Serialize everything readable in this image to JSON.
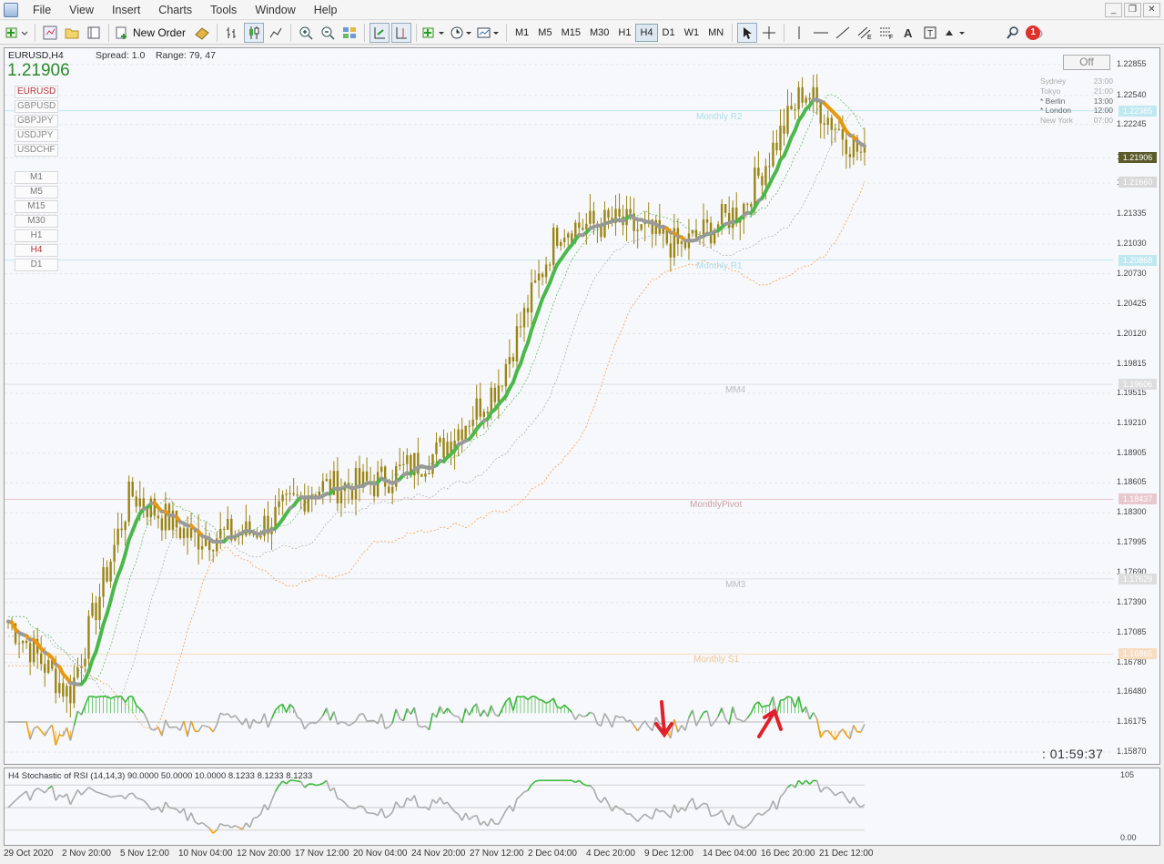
{
  "menubar": {
    "items": [
      "File",
      "View",
      "Insert",
      "Charts",
      "Tools",
      "Window",
      "Help"
    ]
  },
  "toolbar": {
    "new_order_label": "New Order",
    "timeframes": [
      "M1",
      "M5",
      "M15",
      "M30",
      "H1",
      "H4",
      "D1",
      "W1",
      "MN"
    ],
    "active_timeframe": "H4",
    "notification_count": "1"
  },
  "chart": {
    "title": "EURUSD,H4",
    "bid": "1.21906",
    "spread_label": "Spread: 1.0",
    "range_label": "Range: 79, 47",
    "symbols": [
      "EURUSD",
      "GBPUSD",
      "GBPJPY",
      "USDJPY",
      "USDCHF"
    ],
    "selected_symbol": "EURUSD",
    "timeframes_panel": [
      "M1",
      "M5",
      "M15",
      "M30",
      "H1",
      "H4",
      "D1"
    ],
    "selected_tf_panel": "H4",
    "off_button": "Off",
    "sessions": [
      {
        "name": "Sydney",
        "time": "23:00",
        "active": false
      },
      {
        "name": "Tokyo",
        "time": "21:00",
        "active": false
      },
      {
        "name": "* Berlin",
        "time": "13:00",
        "active": true
      },
      {
        "name": "* London",
        "time": "12:00",
        "active": true
      },
      {
        "name": "New York",
        "time": "07:00",
        "active": false
      }
    ],
    "countdown": ":   01:59:37",
    "levels": [
      {
        "label": "Monthly R2",
        "price": 1.22385,
        "color": "#bfe8f0"
      },
      {
        "label": "Monthly R1",
        "price": 1.20868,
        "color": "#bfe8f0"
      },
      {
        "label": "MM4",
        "price": 1.19606,
        "color": "#dddddd"
      },
      {
        "label": "MonthlyPivot",
        "price": 1.18437,
        "color": "#e8c8cc"
      },
      {
        "label": "MM3",
        "price": 1.17629,
        "color": "#dddddd"
      },
      {
        "label": "Monthly S1",
        "price": 1.16865,
        "color": "#f6dcc0"
      }
    ],
    "colors": {
      "candle": "#9a8414",
      "trend_up": "#4cb84c",
      "trend_down": "#e8980e",
      "trend_neutral": "#999999",
      "bid_tag": "#5a5a2a",
      "accent_arrow": "#e0202a"
    }
  },
  "price_axis": {
    "labels": [
      "1.22855",
      "1.22540",
      "1.22245",
      "1.21906",
      "1.21650",
      "1.21335",
      "1.21030",
      "1.20730",
      "1.20425",
      "1.20120",
      "1.19815",
      "1.19515",
      "1.19210",
      "1.18905",
      "1.18605",
      "1.18300",
      "1.17995",
      "1.17690",
      "1.17390",
      "1.17085",
      "1.16780",
      "1.16480",
      "1.16175",
      "1.15870"
    ],
    "current_tag": "1.21906",
    "ref_tag": "1.21660",
    "level_tags": [
      "1.22385",
      "1.20868",
      "1.19606",
      "1.18437",
      "1.17629",
      "1.16865"
    ]
  },
  "stochastic": {
    "title": "H4 Stochastic of RSI (14,14,3) 90.0000 50.0000 10.0000 8.1233 8.1233 8.1233",
    "axis_top": "105",
    "axis_bottom": "0.00"
  },
  "time_axis": {
    "labels": [
      "29 Oct 2020",
      "2 Nov 20:00",
      "5 Nov 12:00",
      "10 Nov 04:00",
      "12 Nov 20:00",
      "17 Nov 12:00",
      "20 Nov 04:00",
      "24 Nov 20:00",
      "27 Nov 12:00",
      "2 Dec 04:00",
      "4 Dec 20:00",
      "9 Dec 12:00",
      "14 Dec 04:00",
      "16 Dec 20:00",
      "21 Dec 12:00"
    ]
  },
  "chart_data": {
    "type": "candlestick",
    "symbol": "EURUSD",
    "timeframe": "H4",
    "ylim": [
      1.1575,
      1.2302
    ],
    "close_path": [
      {
        "x": "29 Oct 2020",
        "y": 1.172
      },
      {
        "x": "2 Nov 20:00",
        "y": 1.1645
      },
      {
        "x": "5 Nov 12:00",
        "y": 1.185
      },
      {
        "x": "10 Nov 04:00",
        "y": 1.1805
      },
      {
        "x": "12 Nov 20:00",
        "y": 1.181
      },
      {
        "x": "17 Nov 12:00",
        "y": 1.1855
      },
      {
        "x": "20 Nov 04:00",
        "y": 1.186
      },
      {
        "x": "24 Nov 20:00",
        "y": 1.189
      },
      {
        "x": "27 Nov 12:00",
        "y": 1.196
      },
      {
        "x": "2 Dec 04:00",
        "y": 1.212
      },
      {
        "x": "4 Dec 20:00",
        "y": 1.2125
      },
      {
        "x": "9 Dec 12:00",
        "y": 1.21
      },
      {
        "x": "14 Dec 04:00",
        "y": 1.214
      },
      {
        "x": "16 Dec 20:00",
        "y": 1.226
      },
      {
        "x": "21 Dec 12:00",
        "y": 1.219
      }
    ]
  }
}
